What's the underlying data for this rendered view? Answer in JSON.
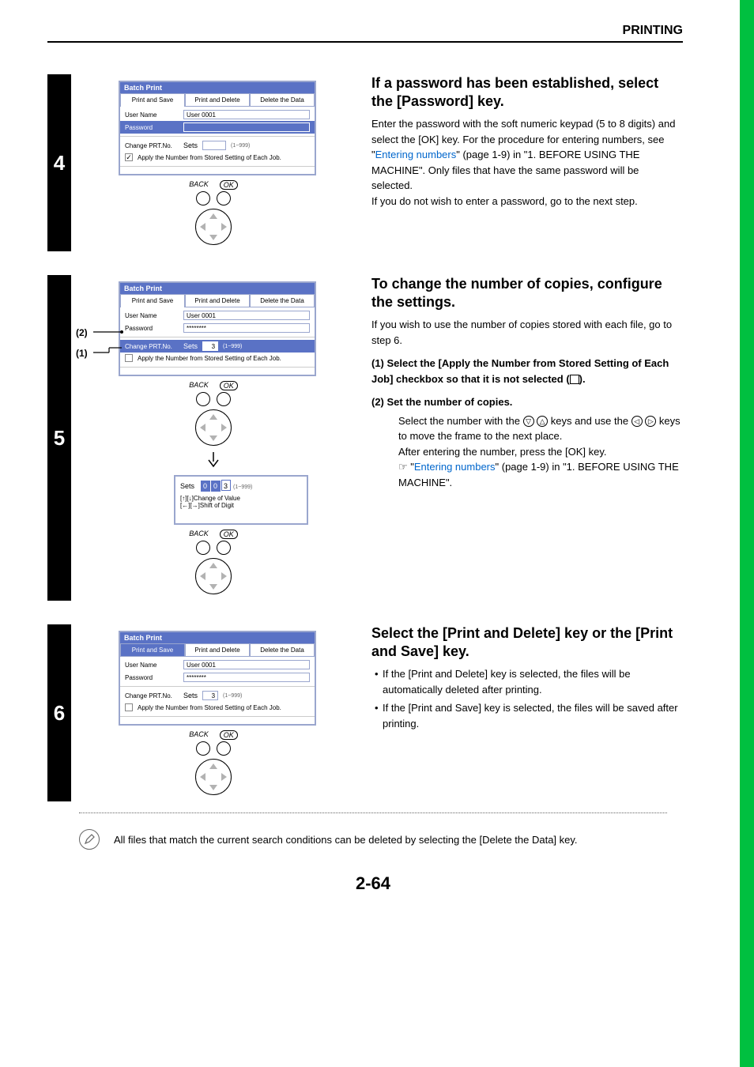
{
  "header": {
    "title": "PRINTING"
  },
  "footer": {
    "page": "2-64"
  },
  "steps": {
    "s4": {
      "num": "4",
      "h": "If a password has been established, select the [Password] key.",
      "p1a": "Enter the password with the soft numeric keypad (5 to 8 digits) and select the [OK] key. For the procedure for entering numbers, see \"",
      "link": "Entering numbers",
      "p1b": "\" (page 1-9) in \"1. BEFORE USING THE MACHINE\". Only files that have the same password will be selected.",
      "p2": "If you do not wish to enter a password, go to the next step.",
      "panel": {
        "title": "Batch Print",
        "tabs": [
          "Print and Save",
          "Print and Delete",
          "Delete the Data"
        ],
        "userLabel": "User Name",
        "userVal": "User 0001",
        "pwLabel": "Password",
        "pwVal": "",
        "chgLabel": "Change PRT.No.",
        "setsLabel": "Sets",
        "setsVal": "",
        "range": "(1~999)",
        "applyChk": true,
        "applyText": "Apply the Number from Stored Setting of Each Job.",
        "back": "BACK",
        "ok": "OK"
      }
    },
    "s5": {
      "num": "5",
      "h": "To change the number of copies, configure the settings.",
      "p1": "If you wish to use the number of copies stored with each file, go to step 6.",
      "li1": "(1)  Select the [Apply the Number from Stored Setting of Each Job] checkbox so that it is not selected (",
      "li1b": ").",
      "li2": "(2)  Set the number of copies.",
      "sub1a": "Select the number with the ",
      "sub1b": " keys and use the ",
      "sub1c": " keys to move the frame to the next place.",
      "sub2": "After entering the number, press the [OK] key.",
      "sub3_pre": "☞ \"",
      "sub3_link": "Entering numbers",
      "sub3_post": "\" (page 1-9)  in \"1. BEFORE USING THE MACHINE\".",
      "anno1": "(1)",
      "anno2": "(2)",
      "panel": {
        "title": "Batch Print",
        "tabs": [
          "Print and Save",
          "Print and Delete",
          "Delete the Data"
        ],
        "userLabel": "User Name",
        "userVal": "User 0001",
        "pwLabel": "Password",
        "pwVal": "********",
        "chgLabel": "Change PRT.No.",
        "setsLabel": "Sets",
        "setsVal": "3",
        "range": "(1~999)",
        "applyChk": false,
        "applyText": "Apply the Number from Stored Setting of Each Job.",
        "back": "BACK",
        "ok": "OK"
      },
      "sets_popup": {
        "label": "Sets",
        "d1": "0",
        "d2": "0",
        "d3": "3",
        "range": "(1~999)",
        "hint1": "[↑][↓]Change of Value",
        "hint2": "[←][→]Shift of Digit",
        "back": "BACK",
        "ok": "OK"
      }
    },
    "s6": {
      "num": "6",
      "h": "Select the [Print and Delete] key or the [Print and Save] key.",
      "b1": "If the [Print and Delete] key is selected, the files will be automatically deleted after printing.",
      "b2": "If the [Print and Save] key is selected, the files will be saved after printing.",
      "panel": {
        "title": "Batch Print",
        "tabs": [
          "Print and Save",
          "Print and Delete",
          "Delete the Data"
        ],
        "userLabel": "User Name",
        "userVal": "User 0001",
        "pwLabel": "Password",
        "pwVal": "********",
        "chgLabel": "Change PRT.No.",
        "setsLabel": "Sets",
        "setsVal": "3",
        "range": "(1~999)",
        "applyChk": false,
        "applyText": "Apply the Number from Stored Setting of Each Job.",
        "back": "BACK",
        "ok": "OK"
      }
    }
  },
  "note": "All files that match the current search conditions can be deleted by selecting the [Delete the Data] key."
}
